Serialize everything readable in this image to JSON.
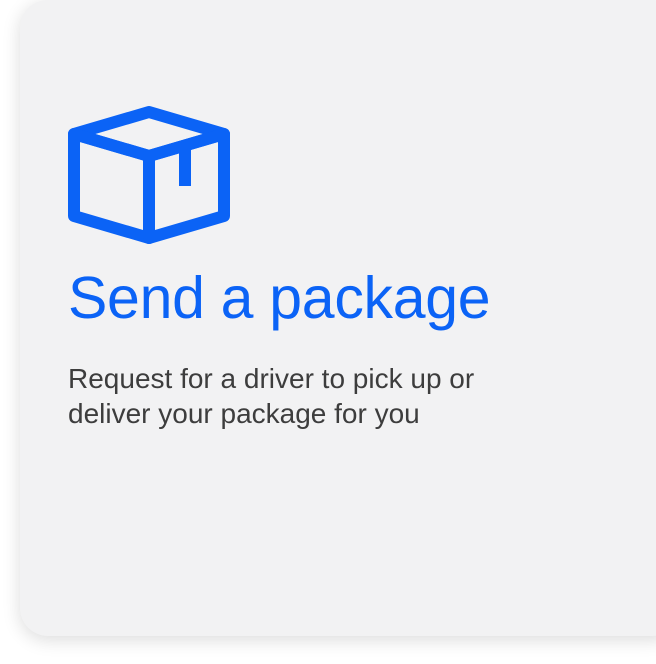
{
  "card": {
    "icon": "package-box-icon",
    "title": "Send a package",
    "description": "Request for a driver to pick up or deliver your package for you"
  },
  "colors": {
    "accent": "#0b63f6",
    "card_background": "#f2f2f3",
    "text": "#3d3d3d"
  }
}
